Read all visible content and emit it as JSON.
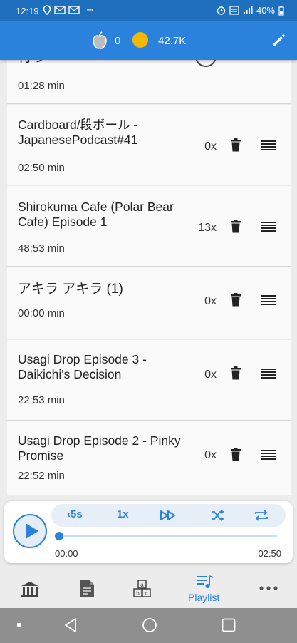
{
  "status": {
    "time": "12:19",
    "battery": "40%"
  },
  "header": {
    "apple_count": "0",
    "coins": "42.7K"
  },
  "list": {
    "partial": {
      "title": "行う",
      "duration": "01:28 min"
    },
    "items": [
      {
        "title": "Cardboard/段ボール - JapanesePodcast#41",
        "duration": "02:50 min",
        "plays": "0x"
      },
      {
        "title": "Shirokuma Cafe (Polar Bear Cafe) Episode 1",
        "duration": "48:53 min",
        "plays": "13x"
      },
      {
        "title": "アキラ アキラ (1)",
        "duration": "00:00 min",
        "plays": "0x"
      },
      {
        "title": "Usagi Drop Episode 3 - Daikichi's Decision",
        "duration": "22:53 min",
        "plays": "0x"
      },
      {
        "title": "Usagi Drop Episode 2 - Pinky Promise",
        "duration": "22:52 min",
        "plays": "0x"
      }
    ]
  },
  "player": {
    "rewind_label": "5s",
    "speed_label": "1x",
    "current_time": "00:00",
    "total_time": "02:50",
    "progress": 0.0
  },
  "tabs": {
    "library_icon": "bank-icon",
    "reader_icon": "document-icon",
    "vocab_icon": "abc-blocks-icon",
    "playlist_label": "Playlist",
    "more_icon": "more-dots-icon"
  },
  "colors": {
    "primary": "#2b82dc",
    "statusbar": "#1f6fbf",
    "coin": "#f5b800"
  }
}
